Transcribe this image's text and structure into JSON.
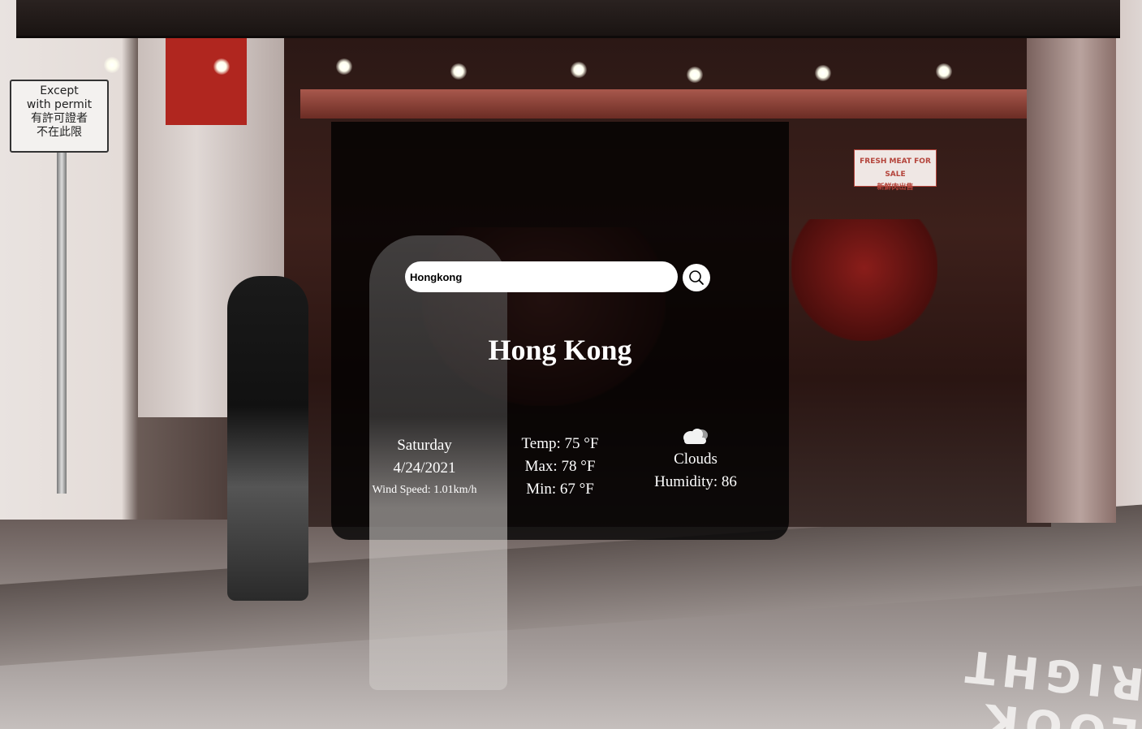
{
  "search": {
    "value": "Hongkong",
    "placeholder": ""
  },
  "weather": {
    "city": "Hong Kong",
    "day": "Saturday",
    "date": "4/24/2021",
    "wind": "Wind Speed: 1.01km/h",
    "temp": "Temp: 75 °F",
    "max": "Max: 78 °F",
    "min": "Min: 67 °F",
    "condition": "Clouds",
    "condition_icon": "cloud-icon",
    "humidity": "Humidity: 86"
  },
  "background": {
    "street_sign": [
      "Except",
      "with permit",
      "有許可證者",
      "不在此限"
    ],
    "meat_sign": [
      "FRESH MEAT FOR SALE",
      "新鮮肉出售"
    ],
    "road_text": "LOOK RIGHT"
  },
  "colors": {
    "card_bg": "#000000",
    "text": "#ffffff",
    "input_bg": "#ffffff"
  }
}
